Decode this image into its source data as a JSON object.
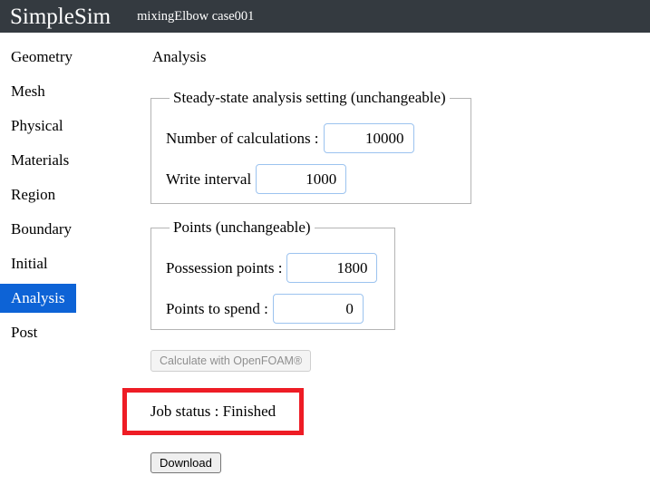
{
  "header": {
    "brand": "SimpleSim",
    "case_label": "mixingElbow case001",
    "bar_color": "#343a40"
  },
  "sidebar": {
    "active_index": 7,
    "active_color": "#0d63d6",
    "items": [
      {
        "label": "Geometry"
      },
      {
        "label": "Mesh"
      },
      {
        "label": "Physical"
      },
      {
        "label": "Materials"
      },
      {
        "label": "Region"
      },
      {
        "label": "Boundary"
      },
      {
        "label": "Initial"
      },
      {
        "label": "Analysis"
      },
      {
        "label": "Post"
      }
    ]
  },
  "main": {
    "page_title": "Analysis",
    "steady_panel": {
      "legend": "Steady-state analysis setting (unchangeable)",
      "num_calculations_label": "Number of calculations :",
      "num_calculations_value": "10000",
      "write_interval_label": "Write interval",
      "write_interval_value": "1000"
    },
    "points_panel": {
      "legend": "Points (unchangeable)",
      "possession_points_label": "Possession points :",
      "possession_points_value": "1800",
      "points_to_spend_label": "Points to spend :",
      "points_to_spend_value": "0"
    },
    "calculate_button_label": "Calculate with OpenFOAM®",
    "job_status_text": "Job status : Finished",
    "job_status_border_color": "#ee1c25",
    "download_button_label": "Download"
  }
}
